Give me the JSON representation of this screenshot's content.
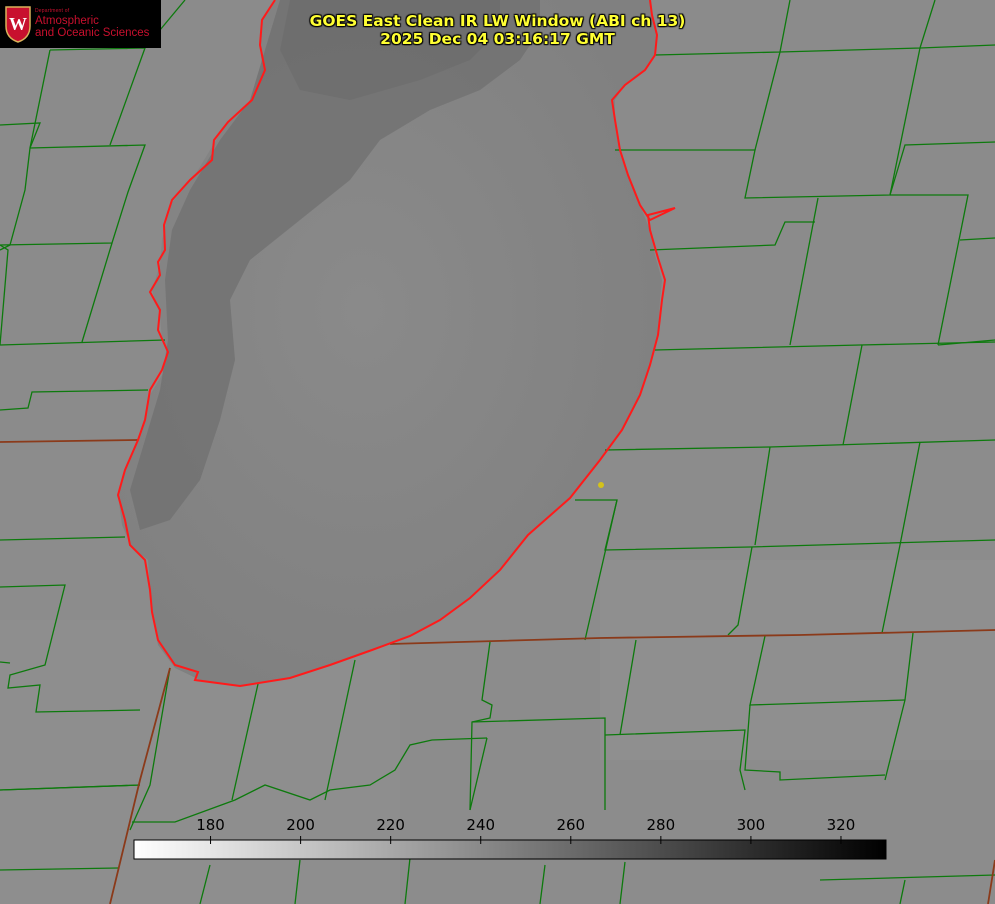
{
  "logo": {
    "department": "Department of",
    "line1": "Atmospheric",
    "line2": "and Oceanic Sciences",
    "seal_letter": "W"
  },
  "title": {
    "line1": "GOES East Clean IR LW Window (ABI ch 13)",
    "line2": "2025 Dec 04 03:16:17 GMT"
  },
  "colorbar": {
    "ticks": [
      "180",
      "200",
      "220",
      "240",
      "260",
      "280",
      "300",
      "320"
    ],
    "range_low": 163,
    "range_high": 330,
    "scale": "white (cold) to black (warm)"
  },
  "colors": {
    "county_lines": "#0d7a0d",
    "state_lines": "#8b3a1a",
    "lake_shore": "#ff1a1a",
    "marker": "#d4c21a",
    "title": "#ffff33"
  }
}
